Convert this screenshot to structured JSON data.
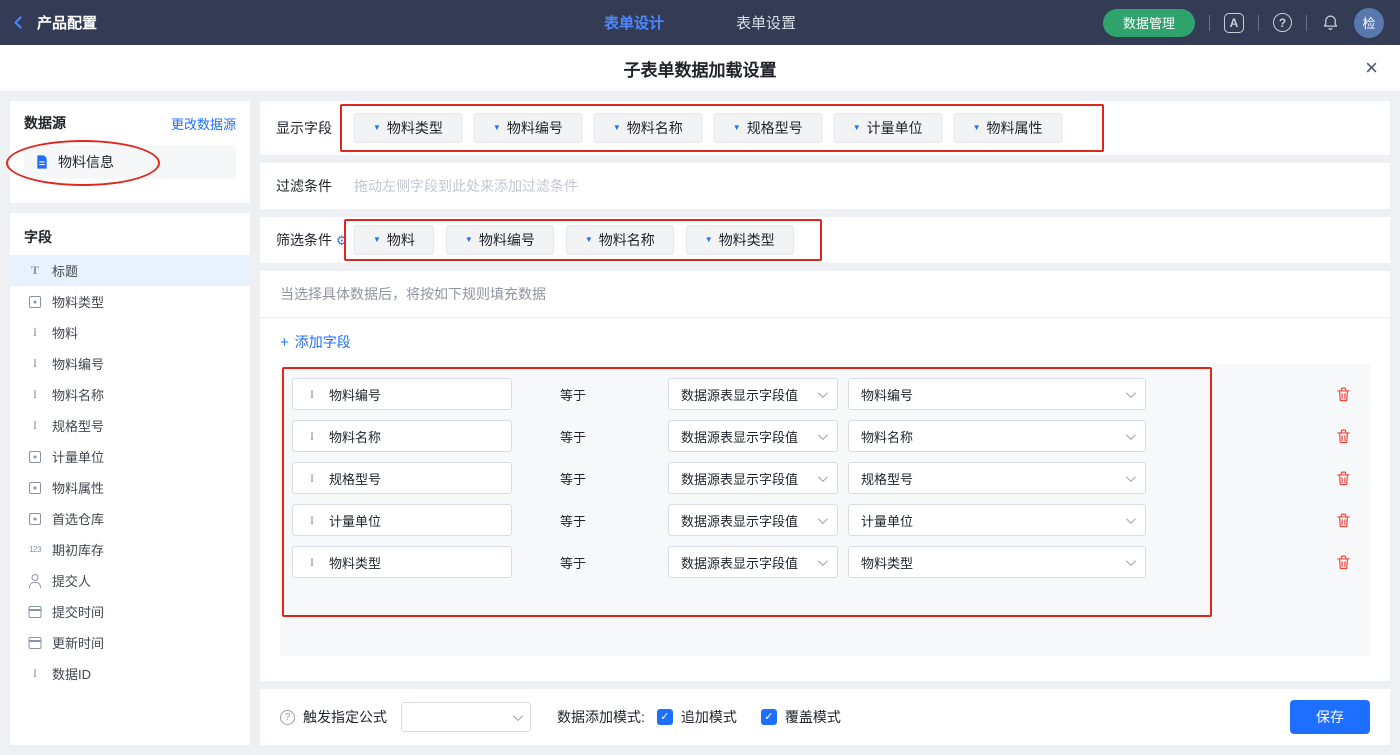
{
  "colors": {
    "topbar": "#333C54",
    "accent": "#1E6FFF",
    "green": "#2FA26E",
    "annotation-red": "#DF271C",
    "trash-red": "#F0483E",
    "bg": "#EEF0F4"
  },
  "topbar": {
    "back_label": "产品配置",
    "tabs": [
      {
        "label": "表单设计",
        "active": true
      },
      {
        "label": "表单设置",
        "active": false
      }
    ],
    "data_manage_button": "数据管理",
    "language_icon_letter": "A",
    "help_icon_glyph": "?",
    "avatar_text": "检"
  },
  "modal": {
    "title": "子表单数据加载设置",
    "close_icon": "×"
  },
  "sidebar": {
    "datasource_title": "数据源",
    "change_datasource_link": "更改数据源",
    "datasource_item": "物料信息",
    "fields_title": "字段",
    "fields": [
      {
        "icon": "title",
        "label": "标题",
        "selected": true
      },
      {
        "icon": "select",
        "label": "物料类型"
      },
      {
        "icon": "text",
        "label": "物料"
      },
      {
        "icon": "text",
        "label": "物料编号"
      },
      {
        "icon": "text",
        "label": "物料名称"
      },
      {
        "icon": "text",
        "label": "规格型号"
      },
      {
        "icon": "select",
        "label": "计量单位"
      },
      {
        "icon": "select",
        "label": "物料属性"
      },
      {
        "icon": "select",
        "label": "首选仓库"
      },
      {
        "icon": "number",
        "label": "期初库存"
      },
      {
        "icon": "user",
        "label": "提交人"
      },
      {
        "icon": "date",
        "label": "提交时间"
      },
      {
        "icon": "date",
        "label": "更新时间"
      },
      {
        "icon": "text",
        "label": "数据ID"
      }
    ]
  },
  "main": {
    "display_section": {
      "label": "显示字段",
      "tags": [
        "物料类型",
        "物料编号",
        "物料名称",
        "规格型号",
        "计量单位",
        "物料属性"
      ]
    },
    "filter_section": {
      "label": "过滤条件",
      "placeholder": "拖动左侧字段到此处来添加过滤条件"
    },
    "screen_section": {
      "label": "筛选条件",
      "tags": [
        "物料",
        "物料编号",
        "物料名称",
        "物料类型"
      ]
    },
    "rules_section": {
      "hint": "当选择具体数据后，将按如下规则填充数据",
      "add_field_label": "添加字段",
      "rules": [
        {
          "field": "物料编号",
          "operator": "等于",
          "source": "数据源表显示字段值",
          "value": "物料编号"
        },
        {
          "field": "物料名称",
          "operator": "等于",
          "source": "数据源表显示字段值",
          "value": "物料名称"
        },
        {
          "field": "规格型号",
          "operator": "等于",
          "source": "数据源表显示字段值",
          "value": "规格型号"
        },
        {
          "field": "计量单位",
          "operator": "等于",
          "source": "数据源表显示字段值",
          "value": "计量单位"
        },
        {
          "field": "物料类型",
          "operator": "等于",
          "source": "数据源表显示字段值",
          "value": "物料类型"
        }
      ]
    }
  },
  "footer": {
    "formula_label": "触发指定公式",
    "formula_value": "",
    "mode_label": "数据添加模式:",
    "modes": [
      {
        "label": "追加模式",
        "checked": true
      },
      {
        "label": "覆盖模式",
        "checked": true
      }
    ],
    "save_button": "保存"
  }
}
